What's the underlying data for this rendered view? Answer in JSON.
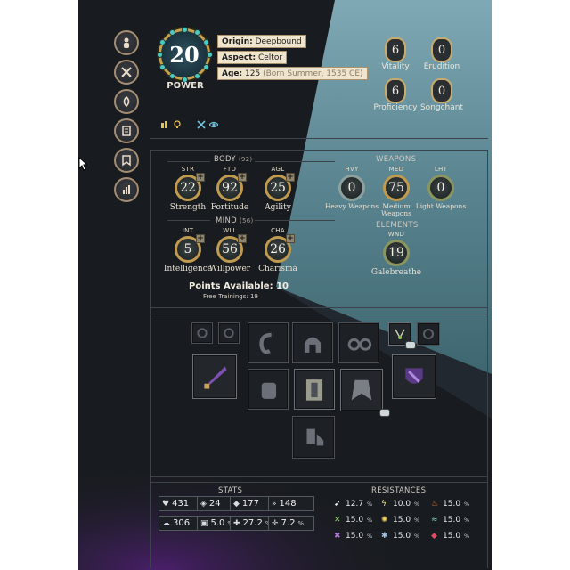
{
  "sidebar": {
    "buttons": [
      {
        "name": "character-tab",
        "icon": "person-icon"
      },
      {
        "name": "skills-tab",
        "icon": "crossed-hammers-icon"
      },
      {
        "name": "abilities-tab",
        "icon": "swirl-icon"
      },
      {
        "name": "journal-tab",
        "icon": "scroll-icon"
      },
      {
        "name": "faction-tab",
        "icon": "banner-icon"
      },
      {
        "name": "stats-tab",
        "icon": "bar-chart-icon"
      }
    ]
  },
  "header": {
    "power_value": "20",
    "power_label": "POWER",
    "origin_label": "Origin:",
    "origin_value": "Deepbound",
    "aspect_label": "Aspect:",
    "aspect_value": "Celtor",
    "age_label": "Age:",
    "age_value": "125",
    "age_note": "(Born Summer, 1535 CE)"
  },
  "top_stats": [
    {
      "label": "Vitality",
      "value": "6"
    },
    {
      "label": "Erudition",
      "value": "0"
    },
    {
      "label": "Proficiency",
      "value": "6"
    },
    {
      "label": "Songchant",
      "value": "0"
    }
  ],
  "flavor_icons": [
    "trophy-icon",
    "bulb-icon",
    "crossed-swords-icon",
    "eye-icon"
  ],
  "body": {
    "title": "BODY",
    "total": "(92)",
    "attributes": [
      {
        "abbr": "STR",
        "name": "Strength",
        "value": "22"
      },
      {
        "abbr": "FTD",
        "name": "Fortitude",
        "value": "92"
      },
      {
        "abbr": "AGL",
        "name": "Agility",
        "value": "25"
      }
    ]
  },
  "mind": {
    "title": "MIND",
    "total": "(56)",
    "attributes": [
      {
        "abbr": "INT",
        "name": "Intelligence",
        "value": "5"
      },
      {
        "abbr": "WLL",
        "name": "Willpower",
        "value": "56"
      },
      {
        "abbr": "CHA",
        "name": "Charisma",
        "value": "26"
      }
    ]
  },
  "weapons": {
    "title": "WEAPONS",
    "items": [
      {
        "abbr": "HVY",
        "name": "Heavy Weapons",
        "value": "0"
      },
      {
        "abbr": "MED",
        "name": "Medium Weapons",
        "value": "75"
      },
      {
        "abbr": "LHT",
        "name": "Light Weapons",
        "value": "0"
      }
    ]
  },
  "elements": {
    "title": "ELEMENTS",
    "items": [
      {
        "abbr": "WND",
        "name": "Galebreathe",
        "value": "19"
      }
    ]
  },
  "points": {
    "label": "Points Available:",
    "value": "10",
    "trainings_label": "Free Trainings:",
    "trainings_value": "19"
  },
  "equipment": {
    "slots": [
      {
        "name": "ring-slot-1",
        "icon": "ring-icon",
        "filled": false
      },
      {
        "name": "ring-slot-2",
        "icon": "ring-icon",
        "filled": false
      },
      {
        "name": "ear-slot",
        "icon": "ear-icon",
        "filled": false
      },
      {
        "name": "helmet-slot",
        "icon": "helmet-icon",
        "filled": false
      },
      {
        "name": "glasses-slot",
        "icon": "glasses-icon",
        "filled": false
      },
      {
        "name": "amulet-slot",
        "icon": "amulet-icon",
        "filled": true
      },
      {
        "name": "ring-slot-3",
        "icon": "ring-icon",
        "filled": false
      },
      {
        "name": "main-hand-slot",
        "icon": "sword-icon",
        "filled": true
      },
      {
        "name": "gloves-slot",
        "icon": "gauntlet-icon",
        "filled": false
      },
      {
        "name": "body-slot",
        "icon": "armor-icon",
        "filled": true
      },
      {
        "name": "cloak-slot",
        "icon": "cloak-icon",
        "filled": true
      },
      {
        "name": "off-hand-slot",
        "icon": "shield-icon",
        "filled": true
      },
      {
        "name": "boots-slot",
        "icon": "boots-icon",
        "filled": false
      }
    ]
  },
  "stats": {
    "title": "STATS",
    "items": [
      {
        "icon": "health-icon",
        "value": "431",
        "suffix": ""
      },
      {
        "icon": "armor-icon",
        "value": "24",
        "suffix": ""
      },
      {
        "icon": "diamond-icon",
        "value": "177",
        "suffix": ""
      },
      {
        "icon": "speed-icon",
        "value": "148",
        "suffix": ""
      },
      {
        "icon": "stamina-icon",
        "value": "306",
        "suffix": ""
      },
      {
        "icon": "block-icon",
        "value": "5.0",
        "suffix": "%"
      },
      {
        "icon": "crit-icon",
        "value": "27.2",
        "suffix": "%"
      },
      {
        "icon": "evade-icon",
        "value": "7.2",
        "suffix": "%"
      }
    ]
  },
  "resistances": {
    "title": "RESISTANCES",
    "items": [
      {
        "icon": "arrow-icon",
        "value": "12.7",
        "suffix": "%",
        "color": "#dfe7ef"
      },
      {
        "icon": "lightning-icon",
        "value": "10.0",
        "suffix": "%",
        "color": "#f1e27a"
      },
      {
        "icon": "fire-icon",
        "value": "15.0",
        "suffix": "%",
        "color": "#ef7a3b"
      },
      {
        "icon": "poison-icon",
        "value": "15.0",
        "suffix": "%",
        "color": "#8fd36a"
      },
      {
        "icon": "sun-icon",
        "value": "15.0",
        "suffix": "%",
        "color": "#f1d25c"
      },
      {
        "icon": "wind-icon",
        "value": "15.0",
        "suffix": "%",
        "color": "#7fd6b7"
      },
      {
        "icon": "void-icon",
        "value": "15.0",
        "suffix": "%",
        "color": "#b57ad9"
      },
      {
        "icon": "frost-icon",
        "value": "15.0",
        "suffix": "%",
        "color": "#9ec4ea"
      },
      {
        "icon": "blood-icon",
        "value": "15.0",
        "suffix": "%",
        "color": "#e04a63"
      }
    ]
  },
  "colors": {
    "gold_frame": "#c8a24a",
    "parchment": "#efe4cd",
    "sky": "#4f7f8c",
    "panel_bg": "#181b1f"
  }
}
